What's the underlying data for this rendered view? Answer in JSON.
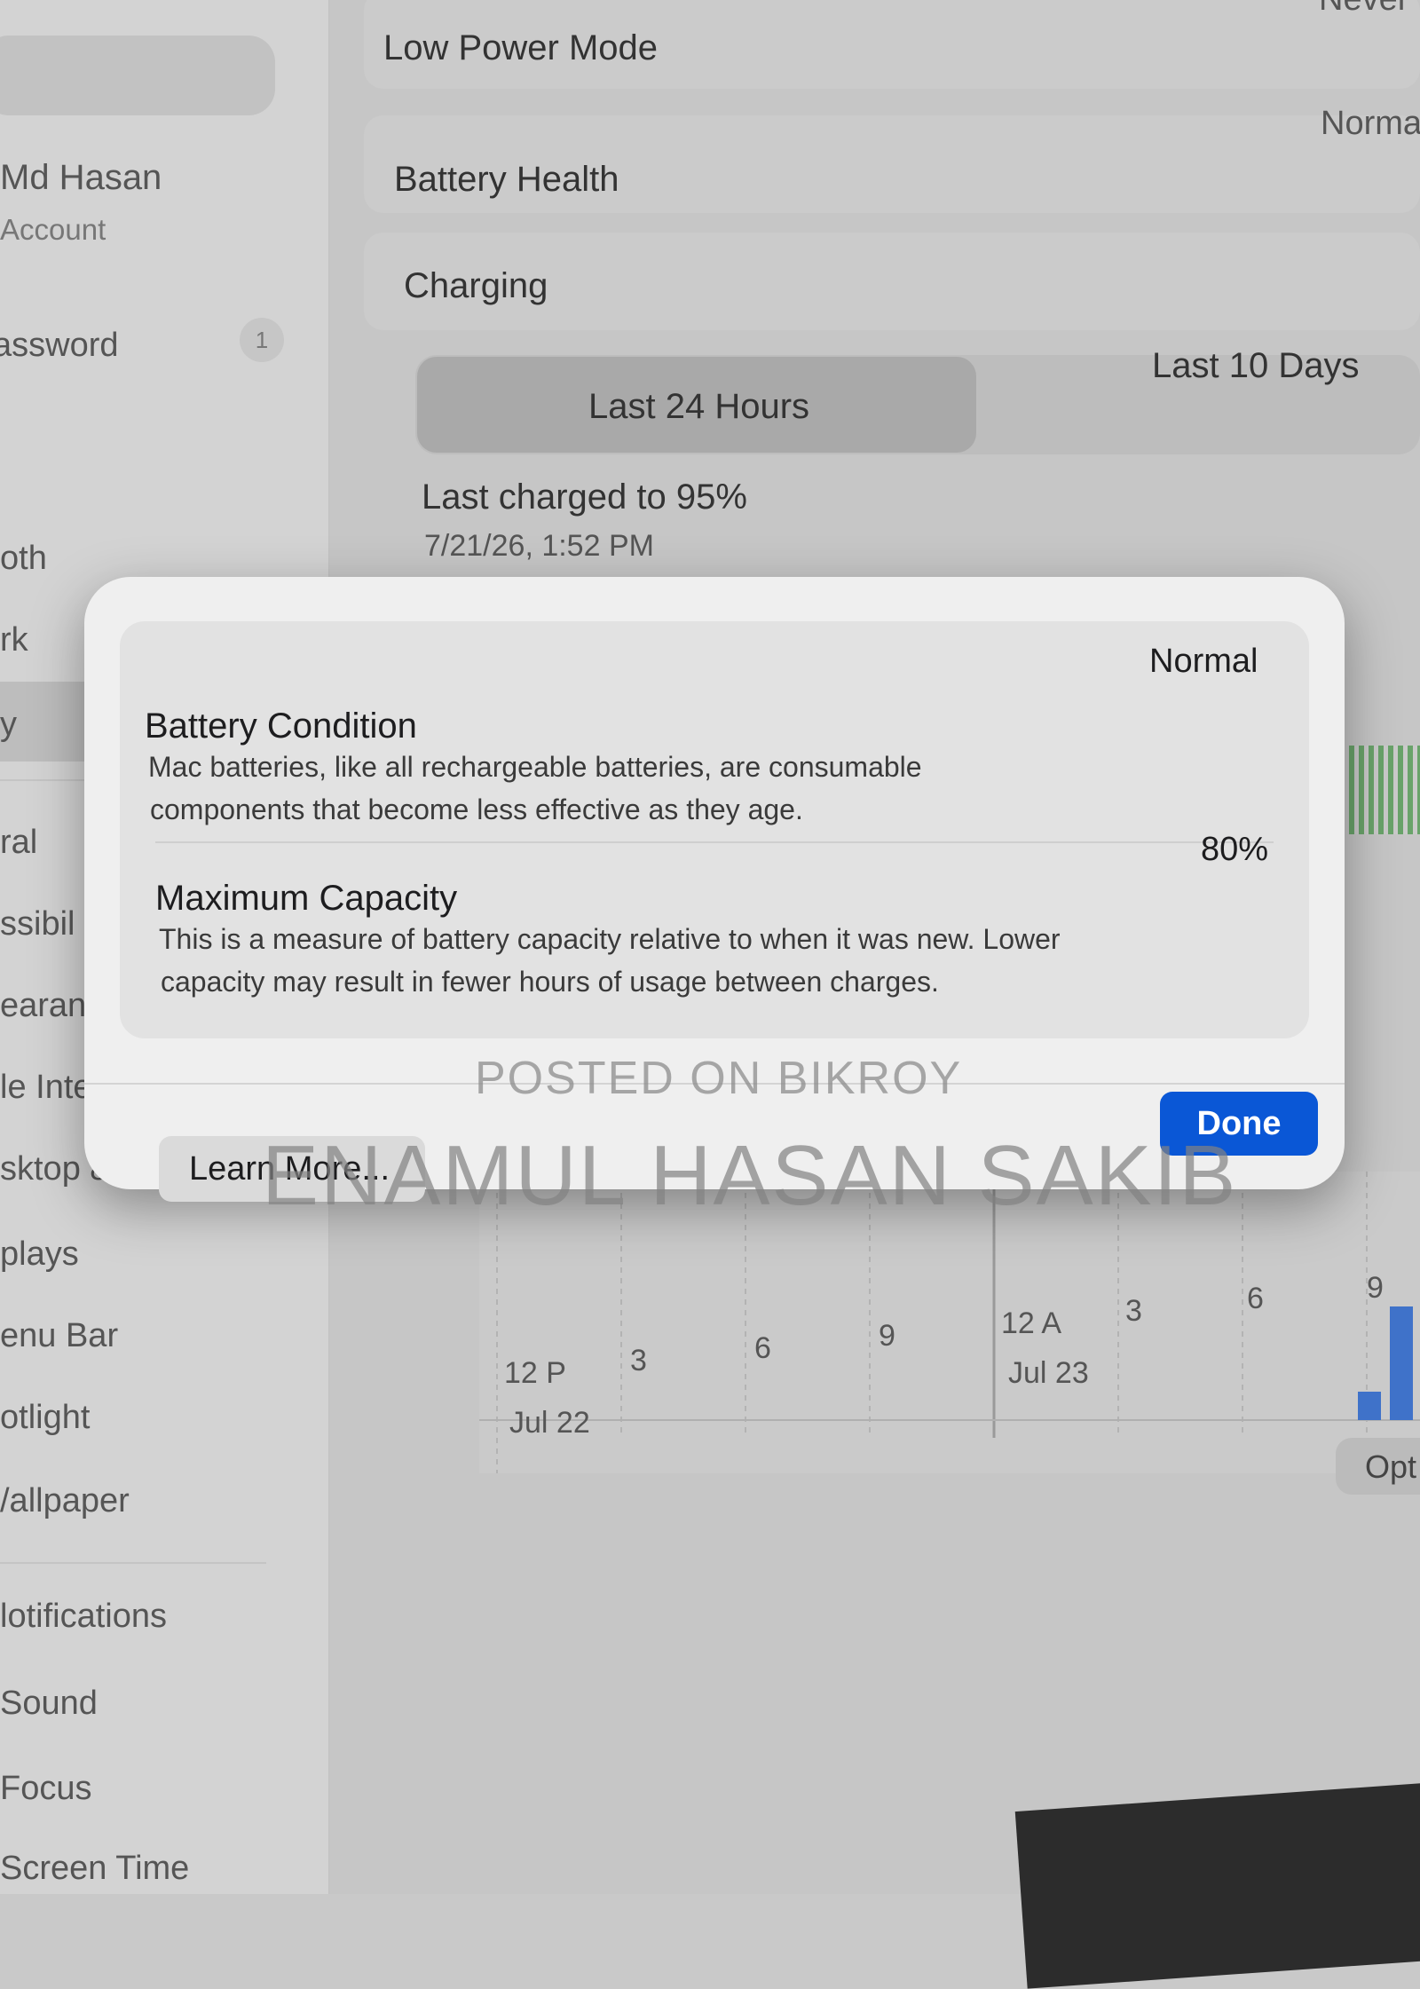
{
  "sidebar": {
    "user_name": "Md Hasan",
    "user_sub": "Account",
    "password": "assword",
    "password_badge": "1",
    "items": [
      "oth",
      "rk",
      "y",
      "ral",
      "ssibil",
      "earanc",
      "le Inte",
      "sktop &",
      "plays",
      "enu Bar",
      "otlight",
      "/allpaper",
      "lotifications",
      "Sound",
      "Focus",
      "Screen Time"
    ]
  },
  "main": {
    "low_power_mode": "Low Power Mode",
    "low_power_value": "Never",
    "battery_health": "Battery Health",
    "battery_health_value": "Norma",
    "charging": "Charging",
    "tabs": [
      "Last 24 Hours",
      "Last 10 Days"
    ],
    "last_charged": "Last charged to 95%",
    "last_charged_time": "7/21/26, 1:52 PM",
    "options_label": "Opt"
  },
  "chart_data": {
    "type": "bar",
    "x_ticks": [
      "12 P",
      "3",
      "6",
      "9",
      "12 A",
      "3",
      "6",
      "9"
    ],
    "date_labels": [
      "Jul 22",
      "Jul 23"
    ],
    "bars": [
      {
        "label": "9",
        "value": 0.8
      }
    ]
  },
  "dialog": {
    "condition_title": "Battery Condition",
    "condition_desc_1": "Mac batteries, like all rechargeable batteries, are consumable",
    "condition_desc_2": "components that become less effective as they age.",
    "condition_value": "Normal",
    "capacity_title": "Maximum Capacity",
    "capacity_desc_1": "This is a measure of battery capacity relative to when it was new. Lower",
    "capacity_desc_2": "capacity may result in fewer hours of usage between charges.",
    "capacity_value": "80%",
    "done": "Done",
    "learn_more": "Learn More..."
  },
  "watermark": {
    "line1": "POSTED ON BIKROY",
    "line2": "ENAMUL HASAN SAKIB"
  },
  "colors": {
    "accent": "#0a57d6",
    "bar": "#3f72c9",
    "green": "#69a36a"
  }
}
